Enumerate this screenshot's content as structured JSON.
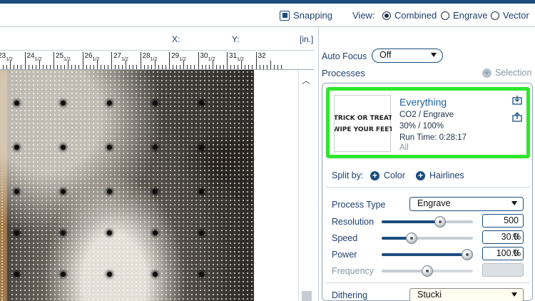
{
  "toolbar": {
    "snapping_label": "Snapping",
    "view_label": "View:",
    "views": [
      "Combined",
      "Engrave",
      "Vector"
    ],
    "selected_view": "Combined"
  },
  "coords": {
    "x_label": "X:",
    "y_label": "Y:",
    "unit": "[in.]"
  },
  "ruler": {
    "labels": [
      {
        "main": "23",
        "frac": "1/2"
      },
      {
        "main": "24",
        "frac": "1/2"
      },
      {
        "main": "25",
        "frac": "1/2"
      },
      {
        "main": "26",
        "frac": "1/2"
      },
      {
        "main": "27",
        "frac": "1/2"
      },
      {
        "main": "28",
        "frac": "1/2"
      },
      {
        "main": "29",
        "frac": "1/2"
      },
      {
        "main": "30",
        "frac": "1/2"
      },
      {
        "main": "31",
        "frac": "1/2"
      },
      {
        "main": "32",
        "frac": ""
      }
    ]
  },
  "panel": {
    "auto_focus_label": "Auto Focus",
    "auto_focus_value": "Off",
    "processes_label": "Processes",
    "selection_label": "Selection",
    "process": {
      "name": "Everything",
      "material": "CO2 / Engrave",
      "power_speed": "30% / 100%",
      "run_time": "Run Time: 0:28:17",
      "scope": "All",
      "thumbnail_lines": [
        "TRICK OR TREAT",
        "WIPE YOUR FEET"
      ]
    },
    "split_by_label": "Split by:",
    "split_color_label": "Color",
    "split_hairlines_label": "Hairlines",
    "process_type_label": "Process Type",
    "process_type_value": "Engrave",
    "resolution_label": "Resolution",
    "resolution_value": "500",
    "resolution_level": 0.66,
    "speed_label": "Speed",
    "speed_value": "30.0",
    "speed_level": 0.3,
    "power_label": "Power",
    "power_value": "100.0",
    "power_level": 1.0,
    "frequency_label": "Frequency",
    "frequency_value": "",
    "frequency_level": 0.5,
    "percent_sign": "%",
    "dithering_label": "Dithering",
    "dithering_value": "Stucki"
  },
  "colors": {
    "accent": "#1b4d7f",
    "highlight": "#2ee62e",
    "link": "#1f5fa0"
  }
}
